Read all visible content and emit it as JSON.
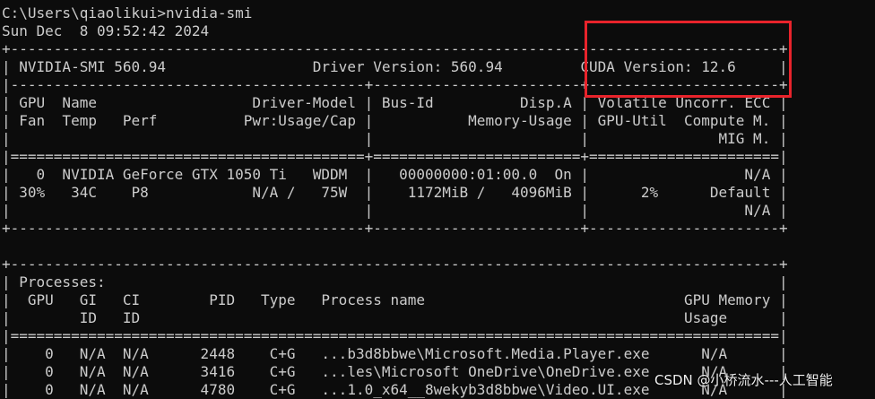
{
  "terminal": {
    "lines": [
      "C:\\Users\\qiaolikui>nvidia-smi",
      "Sun Dec  8 09:52:42 2024",
      "+-----------------------------------------------------------------------------------------+",
      "| NVIDIA-SMI 560.94                 Driver Version: 560.94         CUDA Version: 12.6     |",
      "|-----------------------------------------+------------------------+----------------------+",
      "| GPU  Name                  Driver-Model | Bus-Id          Disp.A | Volatile Uncorr. ECC |",
      "| Fan  Temp   Perf          Pwr:Usage/Cap |           Memory-Usage | GPU-Util  Compute M. |",
      "|                                         |                        |               MIG M. |",
      "|=========================================+========================+======================|",
      "|   0  NVIDIA GeForce GTX 1050 Ti   WDDM  |   00000000:01:00.0  On |                  N/A |",
      "| 30%   34C    P8            N/A /   75W  |    1172MiB /   4096MiB |      2%      Default |",
      "|                                         |                        |                  N/A |",
      "+-----------------------------------------+------------------------+----------------------+",
      "",
      "+-----------------------------------------------------------------------------------------+",
      "| Processes:                                                                              |",
      "|  GPU   GI   CI        PID   Type   Process name                              GPU Memory |",
      "|        ID   ID                                                               Usage      |",
      "|=========================================================================================|",
      "|    0   N/A  N/A      2448    C+G   ...b3d8bbwe\\Microsoft.Media.Player.exe      N/A      |",
      "|    0   N/A  N/A      3416    C+G   ...les\\Microsoft OneDrive\\OneDrive.exe      N/A      |",
      "|    0   N/A  N/A      4780    C+G   ...1.0_x64__8wekyb3d8bbwe\\Video.UI.exe      N/A      |"
    ]
  },
  "watermark": "CSDN @小桥流水---人工智能",
  "colors": {
    "background": "#0c0c0c",
    "text": "#cccccc",
    "highlight": "#e8232b"
  }
}
